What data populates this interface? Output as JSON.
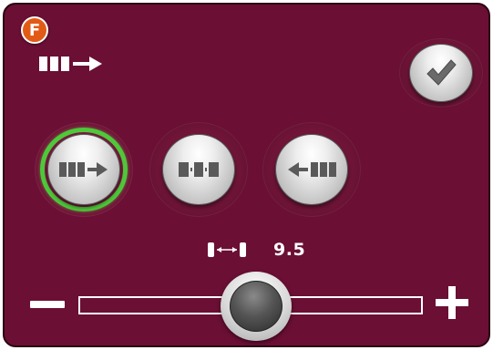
{
  "header": {
    "badge_letter": "F",
    "current_mode_icon": "blocks-right-arrow-icon"
  },
  "buttons": {
    "confirm_icon": "checkmark-icon",
    "modes": [
      {
        "icon": "blocks-right-arrow-icon",
        "selected": true
      },
      {
        "icon": "blocks-centered-icon",
        "selected": false
      },
      {
        "icon": "left-arrow-blocks-icon",
        "selected": false
      }
    ]
  },
  "slider": {
    "icon": "width-spacing-icon",
    "value": "9.5",
    "decrease_icon": "minus-icon",
    "increase_icon": "plus-icon"
  },
  "colors": {
    "panel_bg": "#6b0f34",
    "badge": "#e25b16",
    "selected_ring": "#4ec83a"
  }
}
